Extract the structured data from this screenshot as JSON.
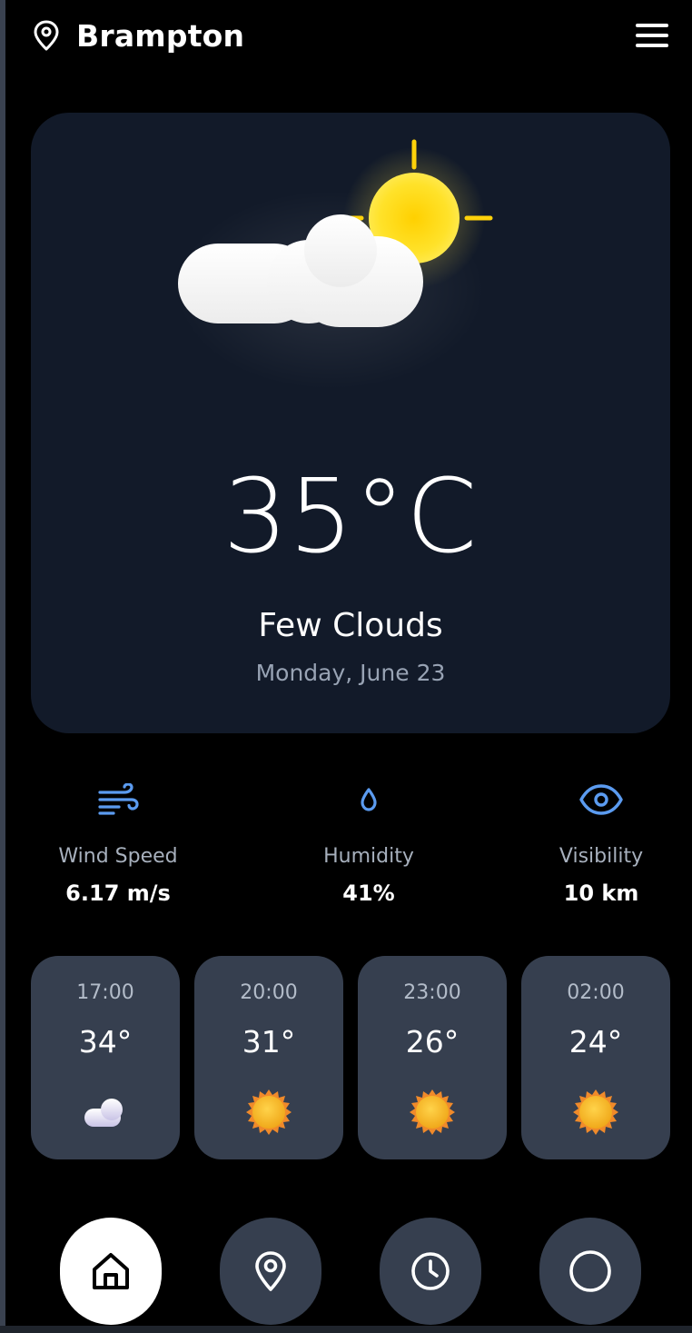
{
  "location": {
    "city": "Brampton",
    "icon": "map-pin-icon"
  },
  "menu": {
    "icon": "hamburger-menu-icon"
  },
  "current": {
    "temperature": "35°C",
    "condition": "Few Clouds",
    "date": "Monday, June 23",
    "icon": "sun-behind-cloud-icon"
  },
  "stats": [
    {
      "icon": "wind-icon",
      "label": "Wind Speed",
      "value": "6.17 m/s"
    },
    {
      "icon": "droplet-icon",
      "label": "Humidity",
      "value": "41%"
    },
    {
      "icon": "eye-icon",
      "label": "Visibility",
      "value": "10 km"
    }
  ],
  "hourly": [
    {
      "time": "17:00",
      "temp": "34°",
      "icon": "cloud-icon"
    },
    {
      "time": "20:00",
      "temp": "31°",
      "icon": "sun-icon"
    },
    {
      "time": "23:00",
      "temp": "26°",
      "icon": "sun-icon"
    },
    {
      "time": "02:00",
      "temp": "24°",
      "icon": "sun-icon"
    }
  ],
  "nav": [
    {
      "icon": "home-icon",
      "active": true
    },
    {
      "icon": "map-pin-icon",
      "active": false
    },
    {
      "icon": "clock-icon",
      "active": false
    },
    {
      "icon": "circle-icon",
      "active": false
    }
  ],
  "colors": {
    "background": "#000000",
    "card": "#121a29",
    "tile": "#363f4f",
    "accent": "#5b9bf0",
    "sun": "#ffd20a"
  }
}
